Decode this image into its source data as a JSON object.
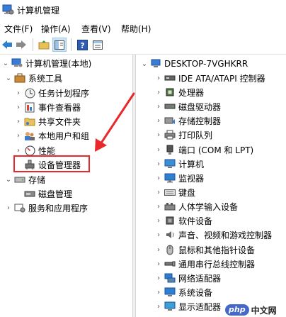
{
  "window": {
    "title": "计算机管理"
  },
  "menu": [
    "文件(F)",
    "操作(A)",
    "查看(V)",
    "帮助(H)"
  ],
  "left_tree": {
    "root": "计算机管理(本地)",
    "items": [
      {
        "label": "系统工具",
        "icon": "toolbox-icon"
      },
      {
        "label": "任务计划程序",
        "icon": "clock-icon"
      },
      {
        "label": "事件查看器",
        "icon": "event-viewer-icon"
      },
      {
        "label": "共享文件夹",
        "icon": "shared-folder-icon"
      },
      {
        "label": "本地用户和组",
        "icon": "users-icon"
      },
      {
        "label": "性能",
        "icon": "performance-icon"
      },
      {
        "label": "设备管理器",
        "icon": "device-manager-icon"
      },
      {
        "label": "存储",
        "icon": "storage-icon"
      },
      {
        "label": "磁盘管理",
        "icon": "disk-management-icon"
      },
      {
        "label": "服务和应用程序",
        "icon": "services-icon"
      }
    ]
  },
  "right_tree": {
    "root": "DESKTOP-7VGHKRR",
    "items": [
      {
        "label": "IDE ATA/ATAPI 控制器",
        "icon": "ide-controller-icon"
      },
      {
        "label": "处理器",
        "icon": "processor-icon"
      },
      {
        "label": "磁盘驱动器",
        "icon": "disk-drive-icon"
      },
      {
        "label": "存储控制器",
        "icon": "storage-controller-icon"
      },
      {
        "label": "打印队列",
        "icon": "printer-icon"
      },
      {
        "label": "端口 (COM 和 LPT)",
        "icon": "port-icon"
      },
      {
        "label": "计算机",
        "icon": "computer-icon"
      },
      {
        "label": "监视器",
        "icon": "monitor-icon"
      },
      {
        "label": "键盘",
        "icon": "keyboard-icon"
      },
      {
        "label": "人体学输入设备",
        "icon": "hid-icon"
      },
      {
        "label": "软件设备",
        "icon": "software-device-icon"
      },
      {
        "label": "声音、视频和游戏控制器",
        "icon": "sound-icon"
      },
      {
        "label": "鼠标和其他指针设备",
        "icon": "mouse-icon"
      },
      {
        "label": "通用串行总线控制器",
        "icon": "usb-icon"
      },
      {
        "label": "网络适配器",
        "icon": "network-adapter-icon"
      },
      {
        "label": "系统设备",
        "icon": "system-device-icon"
      },
      {
        "label": "显示适配器",
        "icon": "display-adapter-icon"
      }
    ]
  },
  "watermark": {
    "badge": "php",
    "text": "中文网"
  },
  "colors": {
    "highlight": "#e8282b",
    "selection": "#cce4f7",
    "accent": "#2f7fd1"
  }
}
